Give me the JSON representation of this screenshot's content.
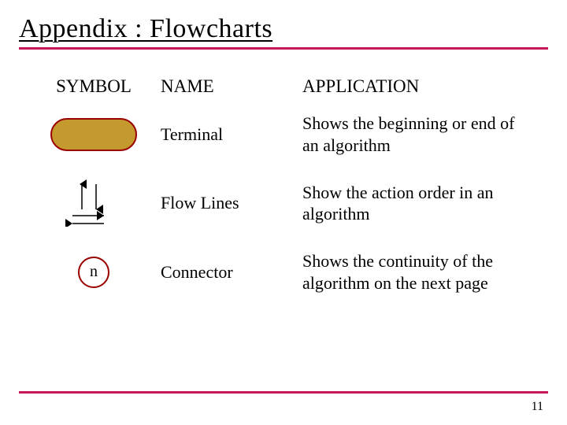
{
  "title": "Appendix : Flowcharts",
  "headers": {
    "symbol": "SYMBOL",
    "name": "NAME",
    "application": "APPLICATION"
  },
  "rows": [
    {
      "symbol_icon": "terminal-shape",
      "name": "Terminal",
      "application": "Shows the beginning or end of an algorithm"
    },
    {
      "symbol_icon": "flowlines-shape",
      "name": "Flow Lines",
      "application": "Show the action order in an algorithm"
    },
    {
      "symbol_icon": "connector-shape",
      "symbol_label": "n",
      "name": "Connector",
      "application": "Shows the continuity of the algorithm on the next page"
    }
  ],
  "page_number": "11",
  "colors": {
    "accent": "#c9175b",
    "shape_border": "#9a0000",
    "shape_fill": "#c49a2f"
  }
}
